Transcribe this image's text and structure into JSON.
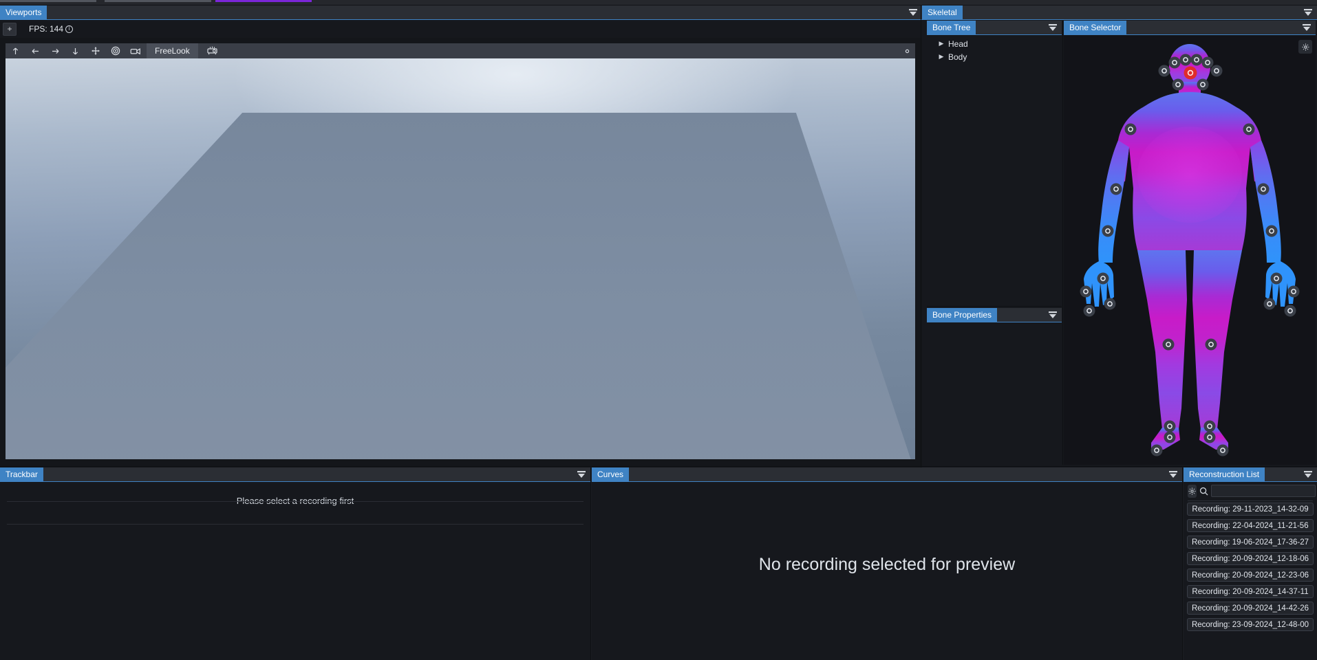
{
  "app": {
    "accent": "#3f83c4",
    "panel_bg": "#16181d",
    "header_bg": "#2b2e34"
  },
  "top_strip": {
    "segments": [
      "tab-sliver-1",
      "tab-sliver-2",
      "tab-sliver-accent"
    ]
  },
  "viewports": {
    "tab_label": "Viewports",
    "add_button_label": "+",
    "fps_label": "FPS: 144",
    "fps_info_glyph": "i",
    "toolbar": {
      "buttons": [
        {
          "name": "move-up-icon",
          "glyph": "↑"
        },
        {
          "name": "move-left-icon",
          "glyph": "←"
        },
        {
          "name": "move-right-icon",
          "glyph": "→"
        },
        {
          "name": "move-down-icon",
          "glyph": "↓"
        },
        {
          "name": "pan-icon",
          "glyph": "✥"
        },
        {
          "name": "target-icon",
          "glyph": "◎"
        },
        {
          "name": "camera-icon",
          "glyph": "camera"
        }
      ],
      "mode_label": "FreeLook",
      "projector_icon": "projector-icon",
      "settings_icon": "gear-icon"
    }
  },
  "skeletal": {
    "tab_label": "Skeletal",
    "bone_tree": {
      "tab_label": "Bone Tree",
      "nodes": [
        {
          "label": "Head",
          "expanded": false
        },
        {
          "label": "Body",
          "expanded": false
        }
      ]
    },
    "bone_properties": {
      "tab_label": "Bone Properties"
    },
    "bone_selector": {
      "tab_label": "Bone Selector",
      "settings_icon": "gear-icon",
      "figure": {
        "gradient_top": "#5b6fe8",
        "gradient_mid": "#c21ec9",
        "gradient_bottom": "#7b4de0",
        "selected_marker_color": "#e02c2c",
        "marker_fill": "#3a3f48",
        "marker_ring": "#e6eaf0"
      }
    }
  },
  "trackbar": {
    "tab_label": "Trackbar",
    "empty_message": "Please select a recording first"
  },
  "curves": {
    "tab_label": "Curves",
    "empty_message": "No recording selected for preview"
  },
  "reconstruction_list": {
    "tab_label": "Reconstruction List",
    "settings_icon": "gear-icon",
    "search_icon": "search-icon",
    "search_value": "",
    "search_placeholder": "",
    "items": [
      "Recording: 29-11-2023_14-32-09",
      "Recording: 22-04-2024_11-21-56",
      "Recording: 19-06-2024_17-36-27",
      "Recording: 20-09-2024_12-18-06",
      "Recording: 20-09-2024_12-23-06",
      "Recording: 20-09-2024_14-37-11",
      "Recording: 20-09-2024_14-42-26",
      "Recording: 23-09-2024_12-48-00"
    ]
  }
}
